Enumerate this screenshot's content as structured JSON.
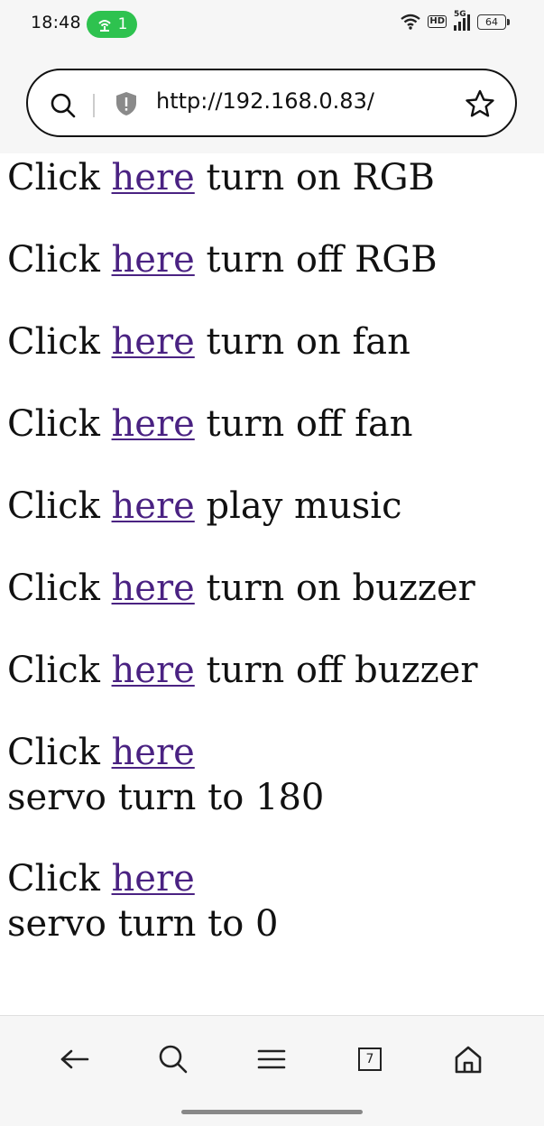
{
  "status_bar": {
    "time": "18:48",
    "hotspot_count": "1",
    "network": "5G",
    "hd_label": "HD",
    "battery": "64",
    "accent_color": "#2ec24f"
  },
  "browser": {
    "url": "http://192.168.0.83/"
  },
  "links": [
    {
      "prefix": "Click ",
      "link": "here",
      "suffix": " turn on RGB"
    },
    {
      "prefix": "Click ",
      "link": "here",
      "suffix": " turn off RGB"
    },
    {
      "prefix": "Click ",
      "link": "here",
      "suffix": " turn on fan"
    },
    {
      "prefix": "Click ",
      "link": "here",
      "suffix": " turn off fan"
    },
    {
      "prefix": "Click ",
      "link": "here",
      "suffix": " play music"
    },
    {
      "prefix": "Click ",
      "link": "here",
      "suffix": " turn on buzzer"
    },
    {
      "prefix": "Click ",
      "link": "here",
      "suffix": " turn off buzzer"
    },
    {
      "prefix": "Click ",
      "link": "here",
      "suffix": "servo turn to 180"
    },
    {
      "prefix": "Click ",
      "link": "here",
      "suffix": "servo turn to 0"
    }
  ],
  "bottom_nav": {
    "tab_count": "7",
    "items": [
      "back-icon",
      "search-icon",
      "menu-icon",
      "tabs-icon",
      "home-icon"
    ]
  },
  "link_color": "#4a2282"
}
